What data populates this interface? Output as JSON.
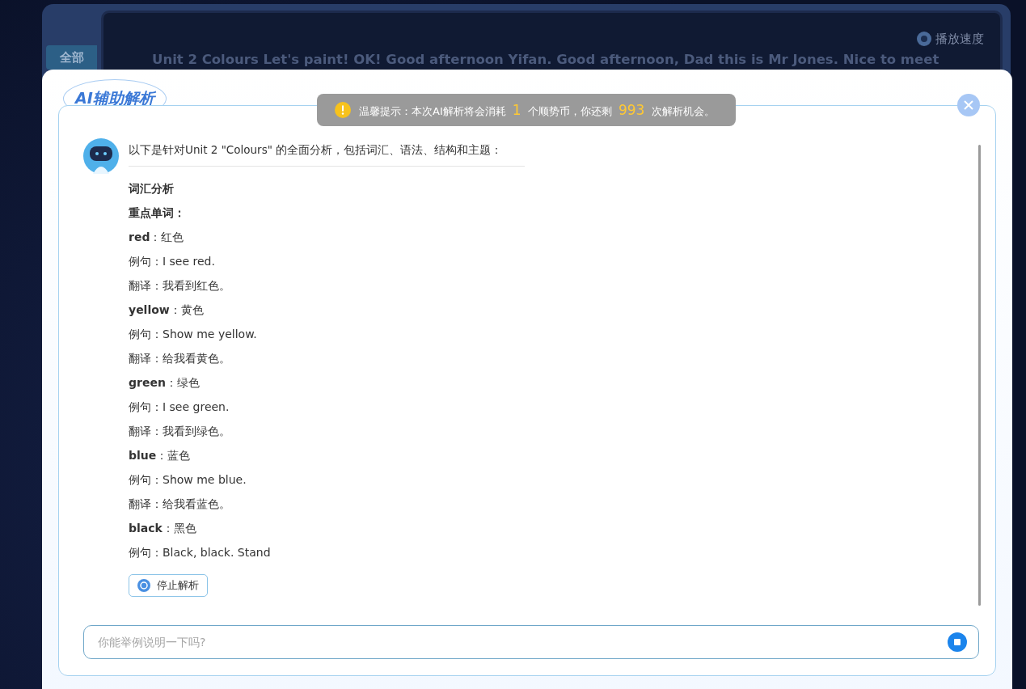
{
  "background": {
    "tab": "全部",
    "speed_label": "播放速度",
    "transcript": "Unit 2 Colours Let's paint! OK! Good afternoon Yifan. Good afternoon, Dad this is Mr Jones. Nice to meet"
  },
  "dialog": {
    "title": "AI辅助解析",
    "notice": {
      "before": "温馨提示：本次AI解析将会消耗",
      "cost": "1",
      "middle": "个顺势币，你还剩",
      "remaining": "993",
      "after": "次解析机会。"
    },
    "intro": "以下是针对Unit 2 \"Colours\" 的全面分析，包括词汇、语法、结构和主题：",
    "lines": [
      {
        "kind": "heading",
        "text": "词汇分析"
      },
      {
        "kind": "heading",
        "text": "重点单词："
      },
      {
        "kind": "text",
        "text": "**red**：红色"
      },
      {
        "kind": "text",
        "text": "例句：I see red."
      },
      {
        "kind": "text",
        "text": "翻译：我看到红色。"
      },
      {
        "kind": "text",
        "text": "**yellow**：黄色"
      },
      {
        "kind": "text",
        "text": "例句：Show me yellow."
      },
      {
        "kind": "text",
        "text": "翻译：给我看黄色。"
      },
      {
        "kind": "text",
        "text": "**green**：绿色"
      },
      {
        "kind": "text",
        "text": "例句：I see green."
      },
      {
        "kind": "text",
        "text": "翻译：我看到绿色。"
      },
      {
        "kind": "text",
        "text": "**blue**：蓝色"
      },
      {
        "kind": "text",
        "text": "例句：Show me blue."
      },
      {
        "kind": "text",
        "text": "翻译：给我看蓝色。"
      },
      {
        "kind": "text",
        "text": "**black**：黑色"
      },
      {
        "kind": "text",
        "text": "例句：Black, black. Stand"
      }
    ],
    "stop_button": "停止解析",
    "input": {
      "placeholder": "你能举例说明一下吗?"
    }
  }
}
